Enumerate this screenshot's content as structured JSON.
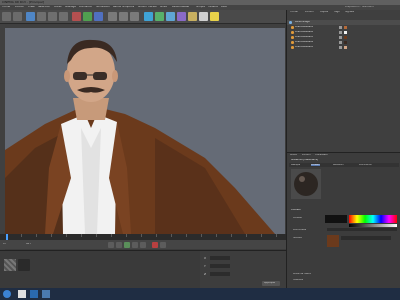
{
  "window": {
    "title": "CINEMA 4D R13 - [Principal]"
  },
  "menu": [
    "Fichier",
    "Edition",
    "Créer",
    "Sélection",
    "Outils",
    "Maillage",
    "Animation",
    "Simulation",
    "Rendu",
    "Sculpture",
    "Motion Tracker",
    "Grille",
    "Personnaliser",
    "Scripts",
    "Fenêtre",
    "Aide"
  ],
  "layout_label": "Disposition : Standard",
  "object_manager": {
    "tabs": [
      "Fichier",
      "Edition",
      "Objets",
      "Tags",
      "Signets"
    ],
    "rows": [
      "Personnage",
      "Aranceldetall1",
      "Aranceldetall2",
      "Aranceldetall3",
      "Aranceldetall4",
      "Aranceldetall5"
    ]
  },
  "attribute_manager": {
    "tabs": [
      "Mode",
      "Edition",
      "Utilisateur"
    ],
    "material_title": "Matériau [Material.6]",
    "channel_tabs": [
      "Basique",
      "Couleur",
      "Réflexion",
      "Luminance"
    ],
    "section": "Couleur",
    "color_label": "Couleur",
    "brightness_label": "Luminosité",
    "texture_label": "Texture",
    "mix_label": "Mode de fusion",
    "mix_strength_label": "Intensité"
  },
  "timeline": {
    "frames": [
      "0",
      "5",
      "10",
      "15",
      "20",
      "25",
      "30",
      "35",
      "40",
      "45",
      "50",
      "55",
      "60",
      "65",
      "70",
      "75",
      "80",
      "85",
      "90"
    ]
  },
  "transport": {
    "start": "0 F",
    "end": "90 F"
  },
  "coords": {
    "labels": [
      "X",
      "Y",
      "Z"
    ],
    "apply_label": "Appliquer"
  },
  "colors": {
    "viewport": "#656b76",
    "jacket": "#6b3a1c",
    "shirt": "#f2f2f2",
    "accent": "#4aa0ff"
  }
}
